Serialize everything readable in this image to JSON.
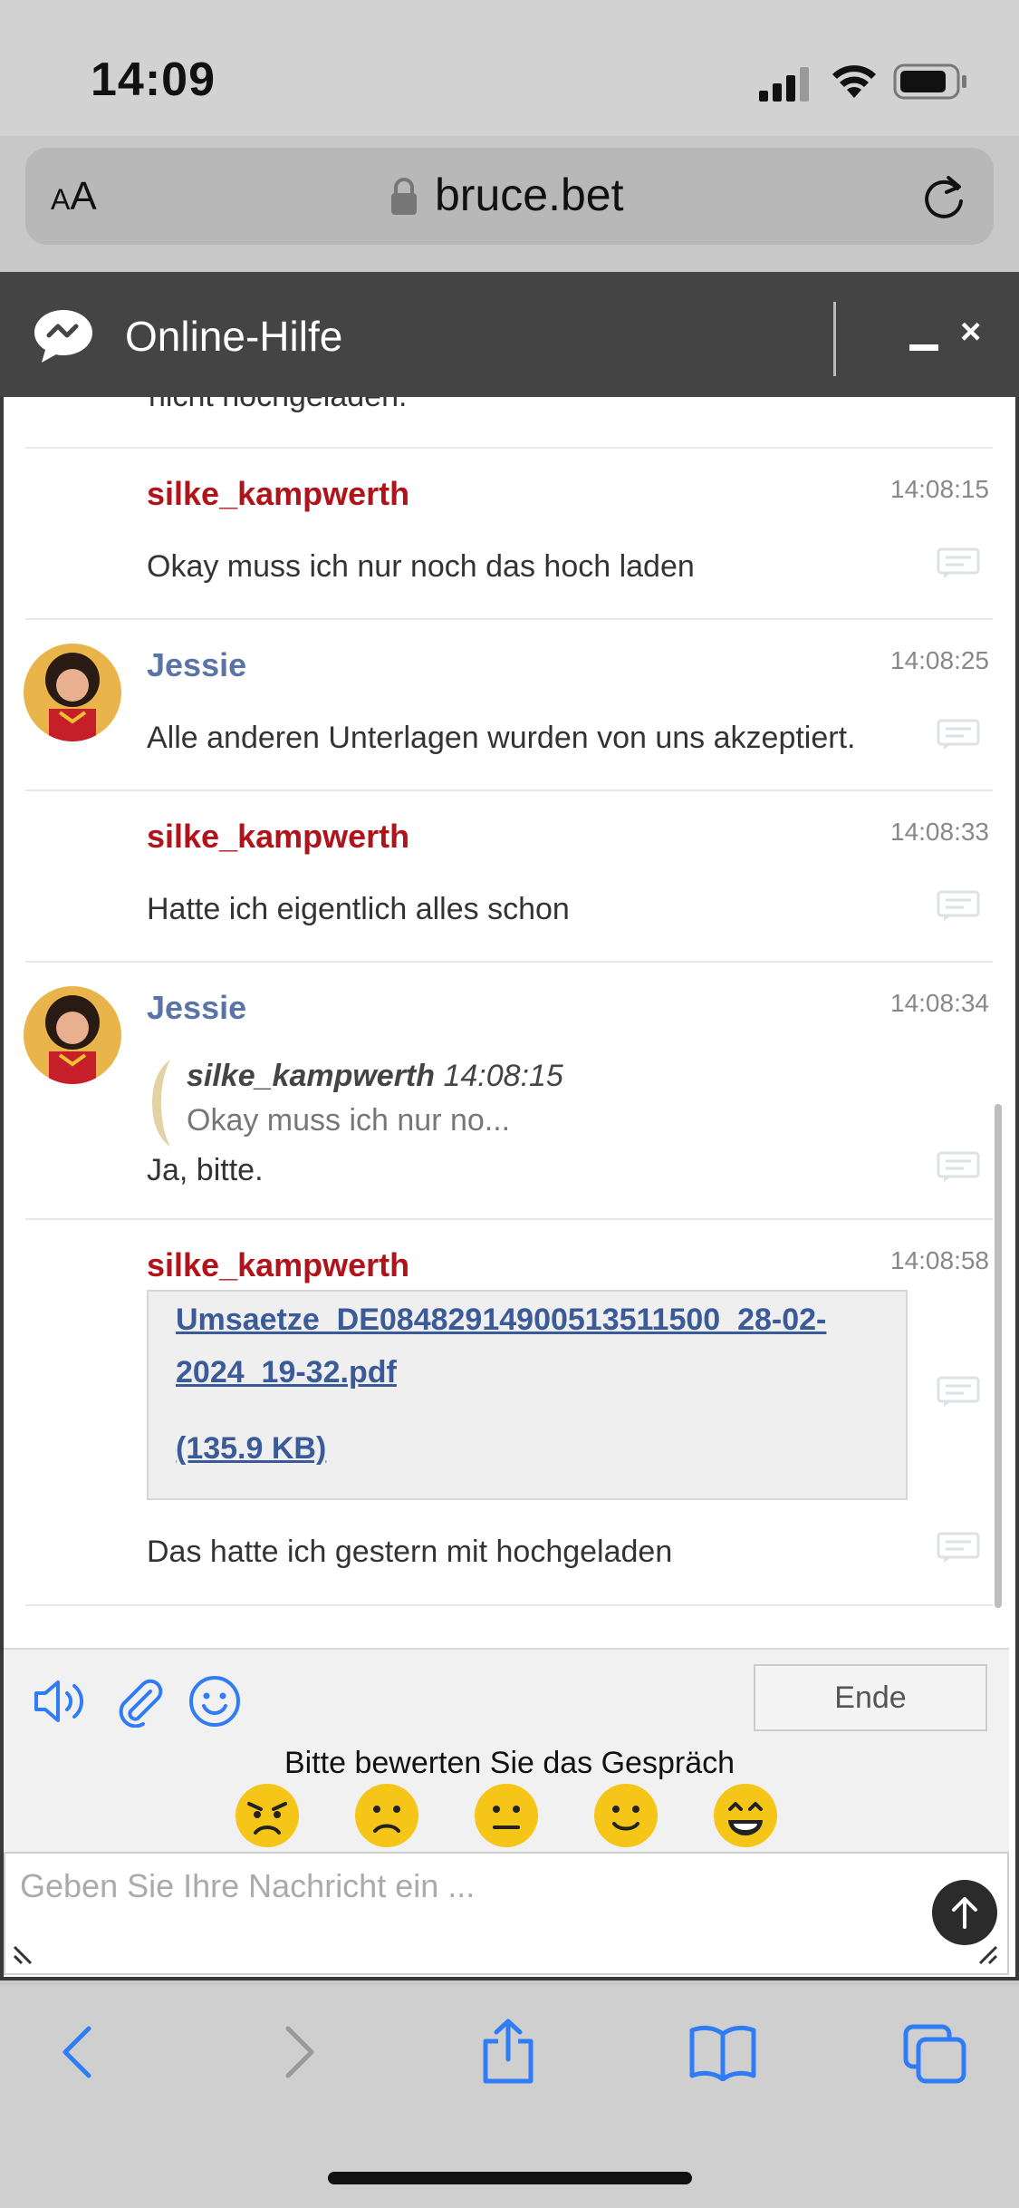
{
  "status_bar": {
    "time": "14:09"
  },
  "browser": {
    "text_size_label_small": "A",
    "text_size_label_large": "A",
    "url": "bruce.bet"
  },
  "chat": {
    "title": "Online-Hilfe",
    "close_label": "×",
    "cut_off_text": "nicht hochgeladen.",
    "messages": [
      {
        "sender": "silke_kampwerth",
        "role": "user",
        "time": "14:08:15",
        "text": "Okay muss ich nur noch das hoch laden"
      },
      {
        "sender": "Jessie",
        "role": "agent",
        "time": "14:08:25",
        "text": "Alle anderen Unterlagen wurden von uns akzeptiert."
      },
      {
        "sender": "silke_kampwerth",
        "role": "user",
        "time": "14:08:33",
        "text": "Hatte ich eigentlich alles schon"
      },
      {
        "sender": "Jessie",
        "role": "agent",
        "time": "14:08:34",
        "quote_author": "silke_kampwerth",
        "quote_time": "14:08:15",
        "quote_text": "Okay muss ich nur no...",
        "text": "Ja, bitte."
      },
      {
        "sender": "silke_kampwerth",
        "role": "user",
        "time": "14:08:58",
        "file_line1": "Umsaetze_DE08482914900513511500_28-02-",
        "file_line2": "2024_19-32.pdf",
        "file_size": "(135.9 KB)",
        "text": "Das hatte ich gestern mit hochgeladen"
      }
    ],
    "end_button": "Ende",
    "rating_prompt": "Bitte bewerten Sie das Gespräch",
    "input_placeholder": "Geben Sie Ihre Nachricht ein ..."
  },
  "colors": {
    "user_name": "#b0141a",
    "agent_name": "#5b74a8",
    "ios_blue": "#2f7cf6",
    "emoji_yellow": "#f5c518"
  },
  "icons": [
    "signal-icon",
    "wifi-icon",
    "battery-icon",
    "lock-icon",
    "reload-icon",
    "chat-logo-icon",
    "reply-icon",
    "sound-icon",
    "attach-icon",
    "emoji-icon",
    "send-arrow-icon",
    "back-icon",
    "forward-icon",
    "share-icon",
    "bookmarks-icon",
    "tabs-icon"
  ]
}
